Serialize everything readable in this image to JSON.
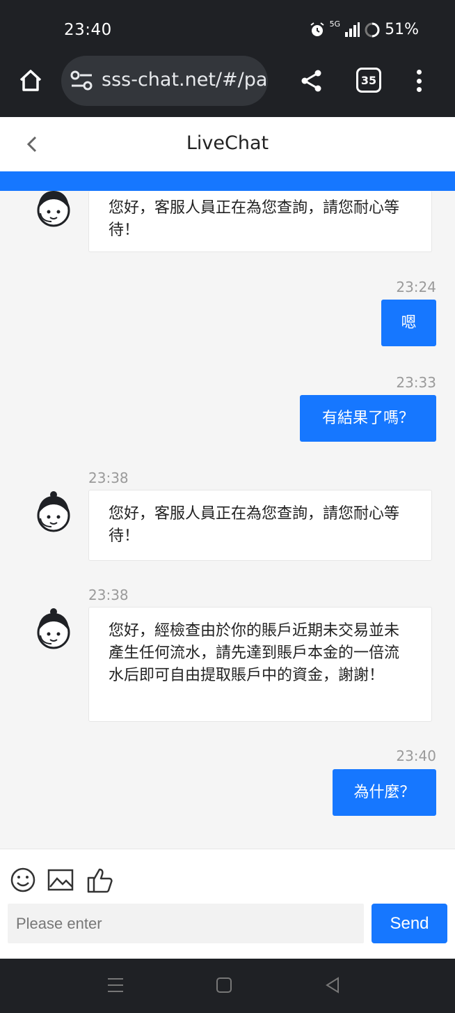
{
  "status": {
    "time": "23:40",
    "signal": "5G",
    "battery": "51%"
  },
  "browser": {
    "url": "sss-chat.net/#/pa",
    "tab_count": "35"
  },
  "header": {
    "title": "LiveChat"
  },
  "messages": [
    {
      "text": "您好，客服人員正在為您查詢，請您耐心等待！"
    },
    {
      "time": "23:24",
      "text": "嗯"
    },
    {
      "time": "23:33",
      "text": "有結果了嗎？"
    },
    {
      "time": "23:38",
      "text": "您好，客服人員正在為您查詢，請您耐心等待！"
    },
    {
      "time": "23:38",
      "text": "您好，經檢查由於你的賬戶近期未交易並未產生任何流水，請先達到賬戶本金的一倍流水后即可自由提取賬戶中的資金，謝謝！"
    },
    {
      "time": "23:40",
      "text": "為什麼？"
    }
  ],
  "composer": {
    "placeholder": "Please enter",
    "send_label": "Send"
  },
  "colors": {
    "accent": "#1677ff",
    "system_bar": "#1f2125"
  }
}
